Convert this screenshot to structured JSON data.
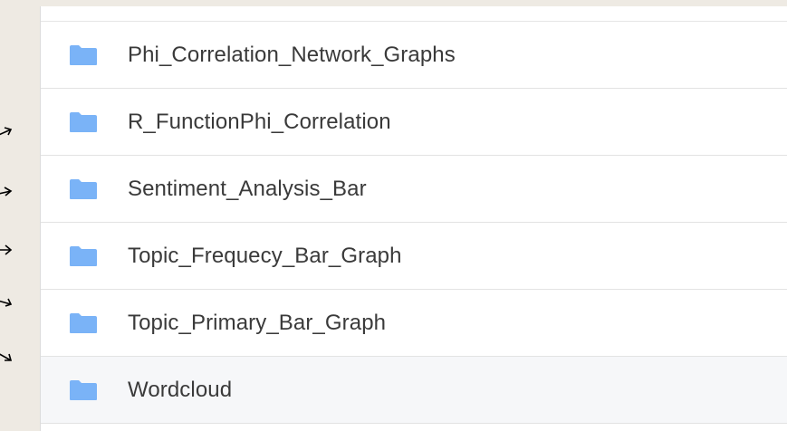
{
  "colors": {
    "background": "#eeeae3",
    "panel": "#ffffff",
    "folder": "#7ab3f7",
    "text": "#3a3a3a",
    "highlight_row": "#f6f7f9"
  },
  "folders": [
    {
      "label": "Phi_Correlation_Network_Graphs",
      "icon": "folder-icon"
    },
    {
      "label": "R_FunctionPhi_Correlation",
      "icon": "folder-icon"
    },
    {
      "label": "Sentiment_Analysis_Bar",
      "icon": "folder-icon"
    },
    {
      "label": "Topic_Frequecy_Bar_Graph",
      "icon": "folder-icon"
    },
    {
      "label": "Topic_Primary_Bar_Graph",
      "icon": "folder-icon"
    },
    {
      "label": "Wordcloud",
      "icon": "folder-icon"
    }
  ],
  "annotations": {
    "arrow_icon": "arrow-icon",
    "arrow_count": 5
  }
}
